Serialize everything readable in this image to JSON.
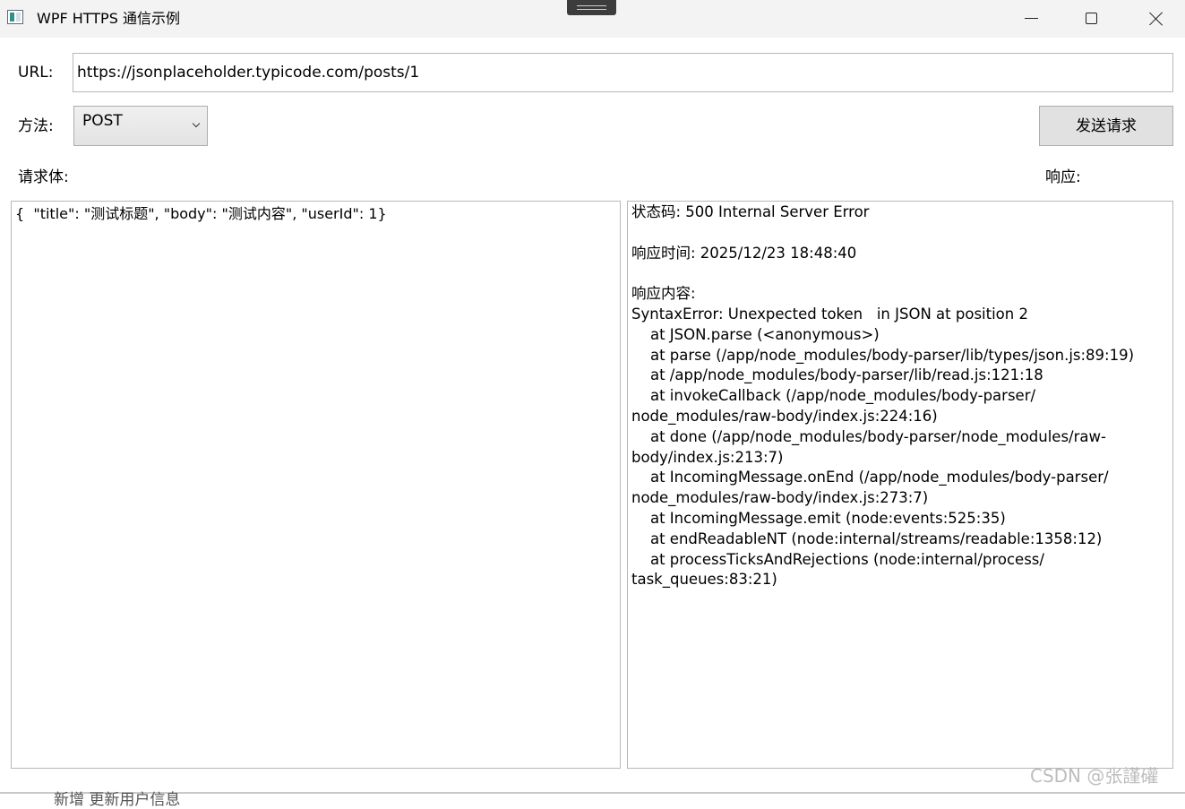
{
  "window": {
    "title": "WPF HTTPS 通信示例",
    "icon": "app-window-icon",
    "controls": [
      "minimize-icon",
      "maximize-icon",
      "close-icon"
    ]
  },
  "form": {
    "url_label": "URL:",
    "url_value": "https://jsonplaceholder.typicode.com/posts/1",
    "method_label": "方法:",
    "method_value": "POST",
    "send_button_label": "发送请求",
    "request_body_label": "请求体:",
    "response_label": "响应:"
  },
  "request_body": {
    "text": "{  \"title\": \"测试标题\", \"body\": \"测试内容\", \"userId\": 1}"
  },
  "response": {
    "lines": [
      "状态码: 500 Internal Server Error",
      "",
      "响应时间: 2025/12/23 18:48:40",
      "",
      "响应内容:",
      "SyntaxError: Unexpected token   in JSON at position 2",
      "    at JSON.parse (<anonymous>)",
      "    at parse (/app/node_modules/body-parser/lib/types/json.js:89:19)",
      "    at /app/node_modules/body-parser/lib/read.js:121:18",
      "    at invokeCallback (/app/node_modules/body-parser/",
      "node_modules/raw-body/index.js:224:16)",
      "    at done (/app/node_modules/body-parser/node_modules/raw-",
      "body/index.js:213:7)",
      "    at IncomingMessage.onEnd (/app/node_modules/body-parser/",
      "node_modules/raw-body/index.js:273:7)",
      "    at IncomingMessage.emit (node:events:525:35)",
      "    at endReadableNT (node:internal/streams/readable:1358:12)",
      "    at processTicksAndRejections (node:internal/process/",
      "task_queues:83:21)"
    ]
  },
  "background": {
    "partial_text": "新增   更新用户信息"
  },
  "watermark": {
    "text": "CSDN @张謹礶"
  },
  "colors": {
    "titlebar_bg": "#f3f3f3",
    "button_bg": "#e1e1e1",
    "border": "#b8b8b8"
  }
}
